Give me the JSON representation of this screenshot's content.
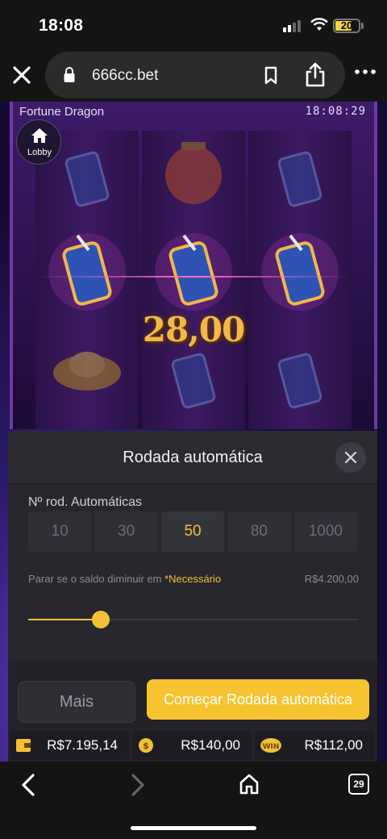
{
  "status_bar": {
    "time": "18:08",
    "battery": "20",
    "battery_color": "#f5d33b"
  },
  "browser": {
    "url": "666cc.bet",
    "icons": [
      "close-icon",
      "lock-icon",
      "bookmark-icon",
      "share-icon",
      "more-icon"
    ]
  },
  "game": {
    "title": "Fortune Dragon",
    "clock": "18:08:29",
    "lobby_label": "Lobby",
    "win_amount": "28,00",
    "symbols": [
      "drink-cup",
      "lantern",
      "gold-ingot"
    ]
  },
  "auto_panel": {
    "title": "Rodada automática",
    "rounds_label": "Nº rod. Automáticas",
    "options": [
      "10",
      "30",
      "50",
      "80",
      "1000"
    ],
    "selected_option": "50",
    "stop_label": "Parar se o saldo diminuir em ",
    "stop_required": "*Necessário",
    "stop_value": "R$4.200,00",
    "slider_value_fraction": 0.22,
    "more_label": "Mais",
    "start_label": "Começar Rodada automática",
    "accent_color": "#f2c037"
  },
  "balances": {
    "balance": "R$7.195,14",
    "bet": "R$140,00",
    "win": "R$112,00"
  },
  "toolbar": {
    "tab_count": "29",
    "icons": [
      "back-icon",
      "forward-icon",
      "home-icon",
      "tabs-icon"
    ]
  }
}
